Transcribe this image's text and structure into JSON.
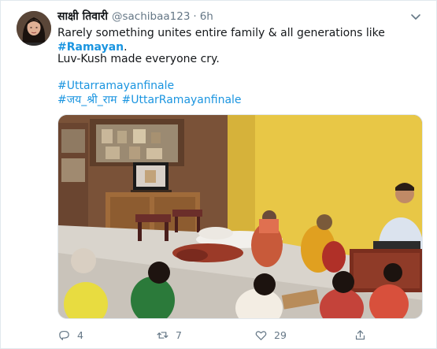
{
  "tweet": {
    "display_name": "साक्षी तिवारी",
    "handle": "@sachibaa123",
    "separator": "·",
    "time": "6h",
    "text_line1_prefix": "Rarely something unites entire family & all generations like ",
    "text_line1_hashtag": "#Ramayan",
    "text_line1_suffix": ".",
    "text_line2": "Luv-Kush made everyone cry.",
    "hashtag1": "#Uttarramayanfinale",
    "hashtag2": "#जय_श्री_राम",
    "hashtag3": "#UttarRamayanfinale"
  },
  "actions": {
    "reply_icon": "reply-icon",
    "reply_count": "4",
    "retweet_icon": "retweet-icon",
    "retweet_count": "7",
    "like_icon": "heart-icon",
    "like_count": "29",
    "share_icon": "share-icon"
  },
  "colors": {
    "link": "#1b95e0",
    "secondary_text": "#657786",
    "wall": "#e8c746",
    "floor": "#d9d4cc"
  }
}
